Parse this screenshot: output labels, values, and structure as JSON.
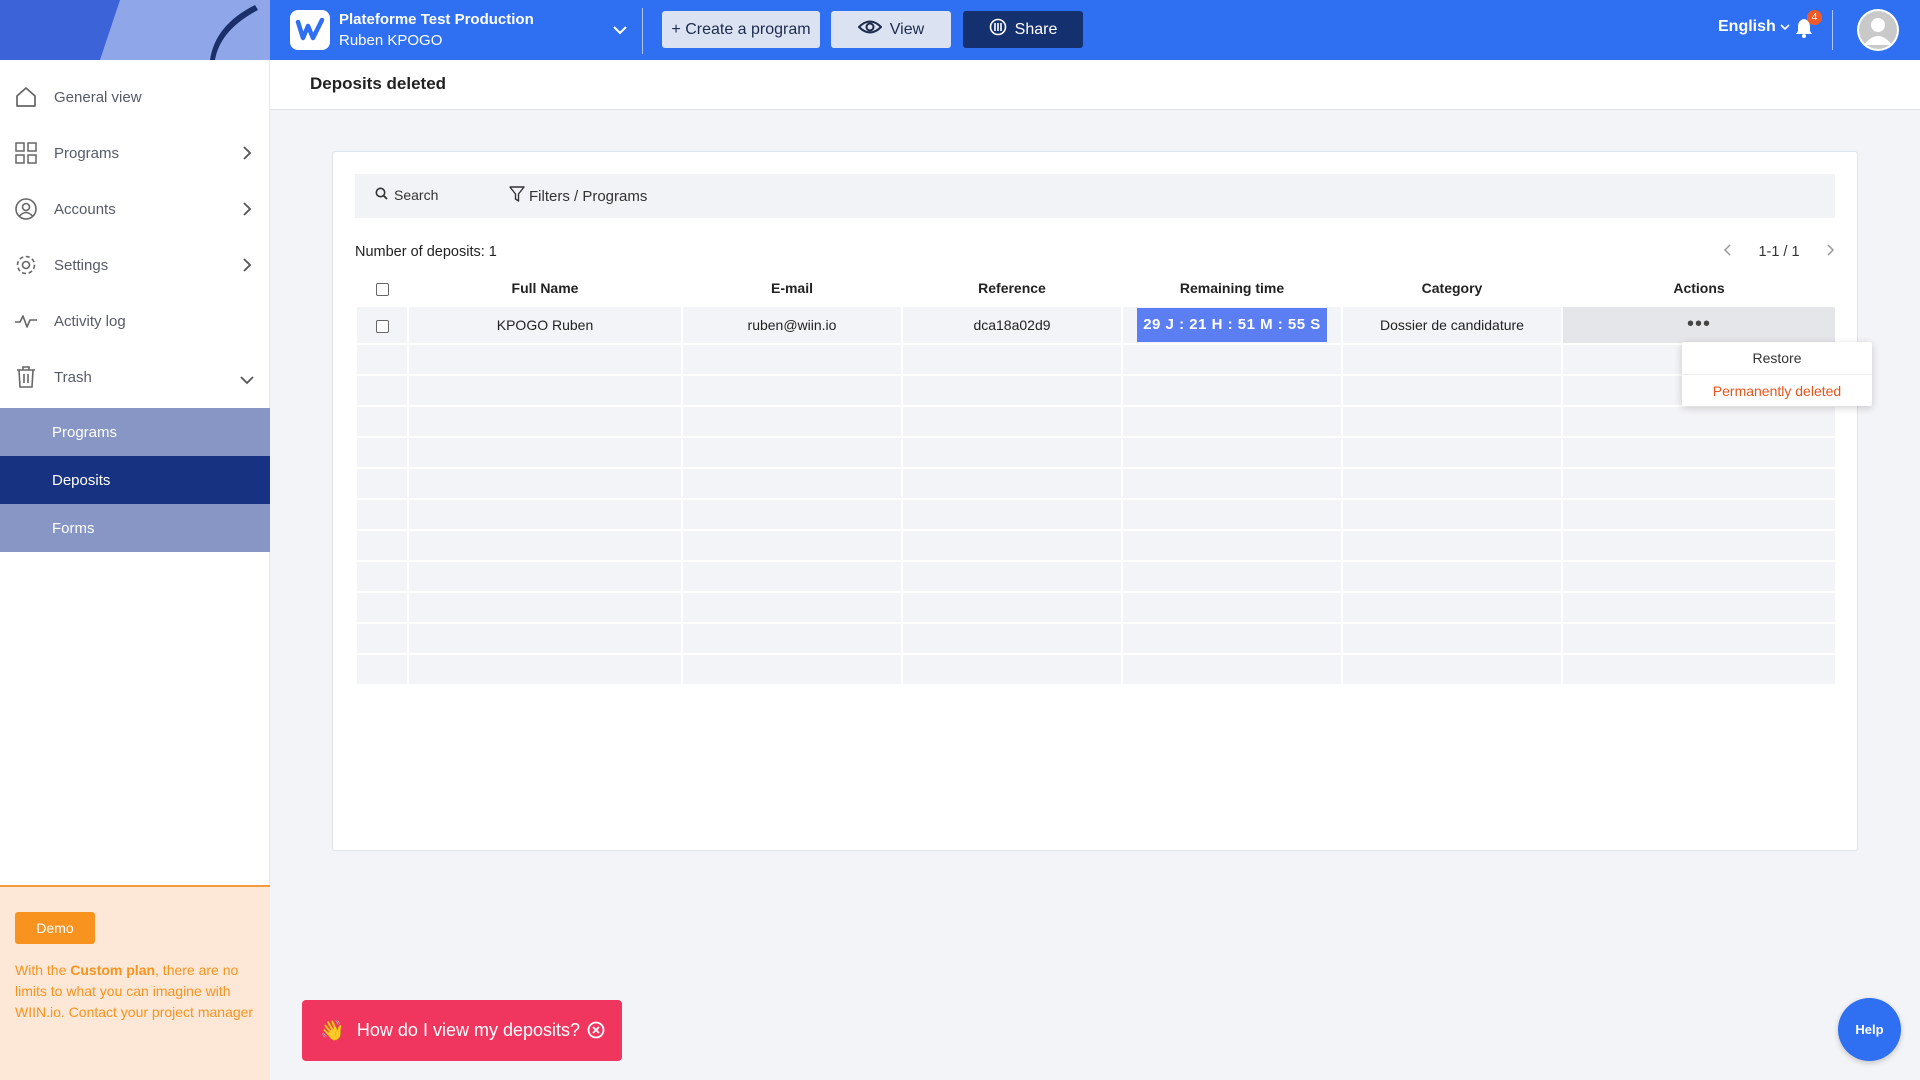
{
  "topbar": {
    "org_name": "Plateforme Test Production",
    "org_user": "Ruben KPOGO",
    "create_label": "+ Create a program",
    "view_label": "View",
    "share_label": "Share",
    "language": "English",
    "notification_count": "4"
  },
  "sidebar": {
    "items": [
      {
        "label": "General view",
        "icon": "home-icon"
      },
      {
        "label": "Programs",
        "icon": "grid-icon"
      },
      {
        "label": "Accounts",
        "icon": "user-circle-icon"
      },
      {
        "label": "Settings",
        "icon": "gear-icon"
      },
      {
        "label": "Activity log",
        "icon": "activity-icon"
      },
      {
        "label": "Trash",
        "icon": "trash-icon"
      }
    ],
    "trash_sub": [
      "Programs",
      "Deposits",
      "Forms"
    ],
    "promo": {
      "demo_label": "Demo",
      "text_before": "With the ",
      "text_bold": "Custom plan",
      "text_after": ", there are no limits to what you can imagine with WIIN.io. Contact your project manager"
    }
  },
  "page": {
    "title": "Deposits deleted"
  },
  "toolbar": {
    "search_label": "Search",
    "filters_label": "Filters / Programs"
  },
  "table": {
    "count_label": "Number of deposits: 1",
    "pagination": "1-1 / 1",
    "columns": [
      "Full Name",
      "E-mail",
      "Reference",
      "Remaining time",
      "Category",
      "Actions"
    ],
    "rows": [
      {
        "full_name": "KPOGO Ruben",
        "email": "ruben@wiin.io",
        "reference": "dca18a02d9",
        "remaining_time": "29 J : 21 H : 51 M : 55 S",
        "category": "Dossier de candidature",
        "actions": "•••"
      }
    ]
  },
  "dropdown": {
    "restore": "Restore",
    "delete": "Permanently deleted"
  },
  "bottom": {
    "howto_label": "How do I view my deposits?",
    "help_label": "Help"
  },
  "colors": {
    "primary": "#2f6ff1",
    "navy": "#173280",
    "accent_orange": "#f7931e",
    "danger": "#e8541c",
    "howto_pink": "#f0365f",
    "timer_blue": "#5b7ef3"
  }
}
